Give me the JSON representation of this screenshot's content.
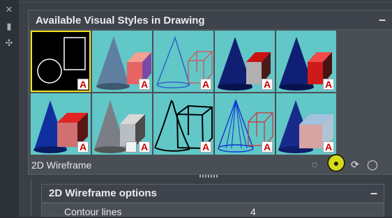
{
  "palette": {
    "side_icons": [
      "close-icon",
      "pin-icon",
      "settings-icon"
    ],
    "section_title": "Available Visual Styles in Drawing",
    "collapse_label": "–",
    "current_style": "2D Wireframe",
    "thumb_badge": "A",
    "options_title": "2D Wireframe options",
    "options_collapse_label": "–",
    "options_rows": [
      {
        "label": "Contour lines",
        "value": "4"
      }
    ],
    "tool_icons": [
      "apply-to-viewport-icon",
      "set-current-icon",
      "export-icon",
      "cleanup-icon"
    ]
  },
  "colors": {
    "thumb_bg": "#62c7c7",
    "selection": "#f2e31b",
    "accent_red": "#cc1111",
    "highlight": "#d5dc16"
  }
}
